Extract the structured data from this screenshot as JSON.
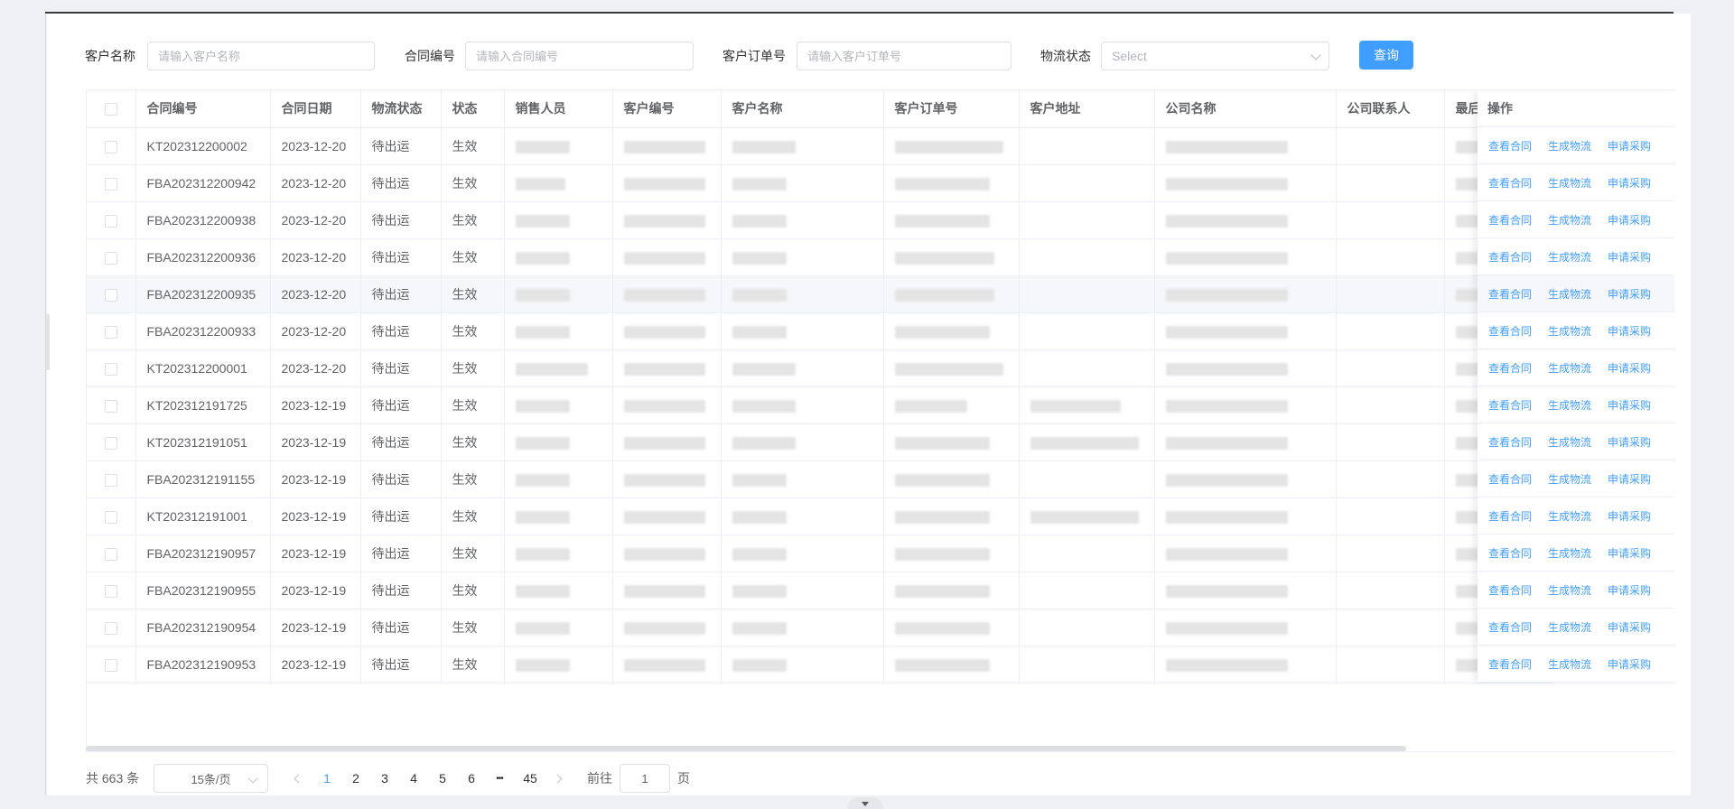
{
  "search": {
    "customer_name_label": "客户名称",
    "customer_name_placeholder": "请输入客户名称",
    "contract_no_label": "合同编号",
    "contract_no_placeholder": "请输入合同编号",
    "order_no_label": "客户订单号",
    "order_no_placeholder": "请输入客户订单号",
    "logistics_status_label": "物流状态",
    "logistics_status_placeholder": "Select",
    "query_button": "查询"
  },
  "table": {
    "columns": [
      "合同编号",
      "合同日期",
      "物流状态",
      "状态",
      "销售人员",
      "客户编号",
      "客户名称",
      "客户订单号",
      "客户地址",
      "公司名称",
      "公司联系人",
      "最后"
    ],
    "action_column": "操作",
    "actions": [
      "查看合同",
      "生成物流",
      "申请采购"
    ],
    "rows": [
      {
        "contract_no": "KT202312200002",
        "date": "2023-12-20",
        "logistics": "待出运",
        "status": "生效"
      },
      {
        "contract_no": "FBA202312200942",
        "date": "2023-12-20",
        "logistics": "待出运",
        "status": "生效"
      },
      {
        "contract_no": "FBA202312200938",
        "date": "2023-12-20",
        "logistics": "待出运",
        "status": "生效"
      },
      {
        "contract_no": "FBA202312200936",
        "date": "2023-12-20",
        "logistics": "待出运",
        "status": "生效"
      },
      {
        "contract_no": "FBA202312200935",
        "date": "2023-12-20",
        "logistics": "待出运",
        "status": "生效"
      },
      {
        "contract_no": "FBA202312200933",
        "date": "2023-12-20",
        "logistics": "待出运",
        "status": "生效"
      },
      {
        "contract_no": "KT202312200001",
        "date": "2023-12-20",
        "logistics": "待出运",
        "status": "生效"
      },
      {
        "contract_no": "KT202312191725",
        "date": "2023-12-19",
        "logistics": "待出运",
        "status": "生效"
      },
      {
        "contract_no": "KT202312191051",
        "date": "2023-12-19",
        "logistics": "待出运",
        "status": "生效"
      },
      {
        "contract_no": "FBA202312191155",
        "date": "2023-12-19",
        "logistics": "待出运",
        "status": "生效"
      },
      {
        "contract_no": "KT202312191001",
        "date": "2023-12-19",
        "logistics": "待出运",
        "status": "生效"
      },
      {
        "contract_no": "FBA202312190957",
        "date": "2023-12-19",
        "logistics": "待出运",
        "status": "生效"
      },
      {
        "contract_no": "FBA202312190955",
        "date": "2023-12-19",
        "logistics": "待出运",
        "status": "生效"
      },
      {
        "contract_no": "FBA202312190954",
        "date": "2023-12-19",
        "logistics": "待出运",
        "status": "生效"
      },
      {
        "contract_no": "FBA202312190953",
        "date": "2023-12-19",
        "logistics": "待出运",
        "status": "生效"
      }
    ],
    "highlighted_row": 4
  },
  "pagination": {
    "total_text": "共 663 条",
    "page_size": "15条/页",
    "pages": [
      "1",
      "2",
      "3",
      "4",
      "5",
      "6"
    ],
    "ellipsis": "•••",
    "last_page": "45",
    "current_page": "1",
    "goto_label": "前往",
    "goto_value": "1",
    "goto_suffix": "页"
  },
  "colors": {
    "primary": "#409eff",
    "border": "#dcdfe6",
    "text": "#606266"
  }
}
